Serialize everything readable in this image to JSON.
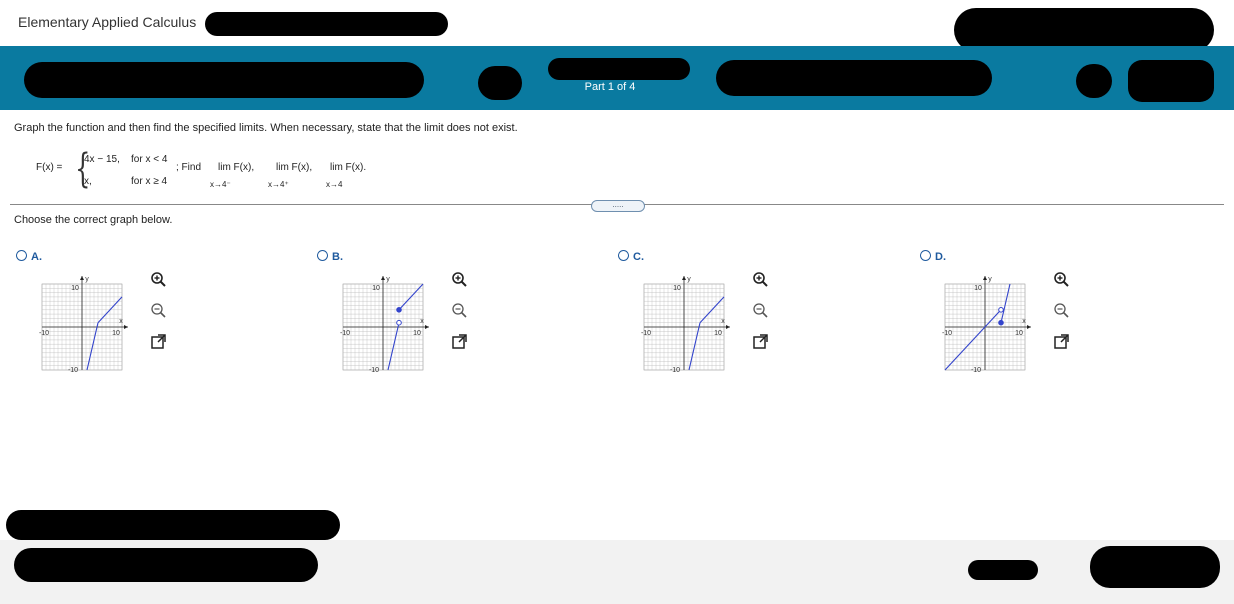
{
  "header": {
    "course_title": "Elementary Applied Calculus"
  },
  "toolbar": {
    "part_label": "Part 1 of 4"
  },
  "question": {
    "instruction": "Graph the function and then find the specified limits. When necessary, state that the limit does not exist.",
    "function_name": "F(x) =",
    "case1_expr": "4x − 15,",
    "case1_cond": "for x < 4",
    "case2_expr": "x,",
    "case2_cond": "for x ≥ 4",
    "find_label": "; Find",
    "lim1": "lim F(x),",
    "lim1_sub": "x→4⁻",
    "lim2": "lim F(x),",
    "lim2_sub": "x→4⁺",
    "lim3": "lim F(x).",
    "lim3_sub": "x→4",
    "more_label": ".....",
    "choose_prompt": "Choose the correct graph below."
  },
  "options": [
    {
      "letter": "A.",
      "axis_max_label": "10",
      "axis_min_label": "-10",
      "x_label": "x",
      "y_label": "y"
    },
    {
      "letter": "B.",
      "axis_max_label": "10",
      "axis_min_label": "-10",
      "x_label": "x",
      "y_label": "y"
    },
    {
      "letter": "C.",
      "axis_max_label": "10",
      "axis_min_label": "-10",
      "x_label": "x",
      "y_label": "y"
    },
    {
      "letter": "D.",
      "axis_max_label": "10",
      "axis_min_label": "-10",
      "x_label": "x",
      "y_label": "y"
    }
  ],
  "colors": {
    "header_bar": "#0a7aa0",
    "option_text": "#1f5a9e",
    "graph_line": "#3344cc"
  },
  "icons": [
    "zoom-in-icon",
    "zoom-out-icon",
    "pop-out-icon"
  ]
}
